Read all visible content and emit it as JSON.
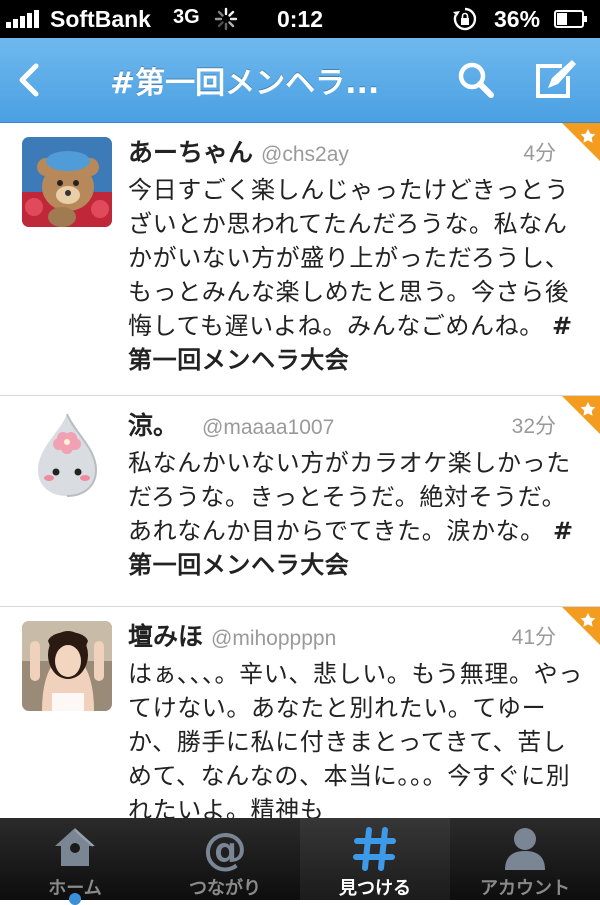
{
  "status_bar": {
    "carrier": "SoftBank",
    "network": "3G",
    "time": "0:12",
    "battery": "36%"
  },
  "nav": {
    "title": "#第一回メンヘラ..."
  },
  "tweets": [
    {
      "name": "あーちゃん",
      "handle": "@chs2ay",
      "time": "4分",
      "text": "今日すごく楽しんじゃったけどきっとうざいとか思われてたんだろうな。私なんかがいない方が盛り上がっただろうし、もっとみんな楽しめたと思う。今さら後悔しても遅いよね。みんなごめんね。",
      "hashtag": "#第一回メンヘラ大会"
    },
    {
      "name": "涼。",
      "handle": "@maaaa1007",
      "time": "32分",
      "text": "私なんかいない方がカラオケ楽しかっただろうな。きっとそうだ。絶対そうだ。あれなんか目からでてきた。涙かな。",
      "hashtag": "#第一回メンヘラ大会"
    },
    {
      "name": "壇みほ",
      "handle": "@mihoppppn",
      "time": "41分",
      "text": "はぁ、、、。辛い、悲しい。もう無理。やってけない。あなたと別れたい。てゆーか、勝手に私に付きまとってきて、苦しめて、なんなの、本当に。。。今すぐに別れたいよ。精神も",
      "hashtag": ""
    }
  ],
  "tabs": [
    {
      "label": "ホーム",
      "icon": "home-icon"
    },
    {
      "label": "つながり",
      "icon": "at-icon"
    },
    {
      "label": "見つける",
      "icon": "hash-icon"
    },
    {
      "label": "アカウント",
      "icon": "person-icon"
    }
  ],
  "colors": {
    "nav_blue": "#4aa0e2",
    "favorite_corner": "#f39c1f",
    "tab_bar": "#111111"
  }
}
